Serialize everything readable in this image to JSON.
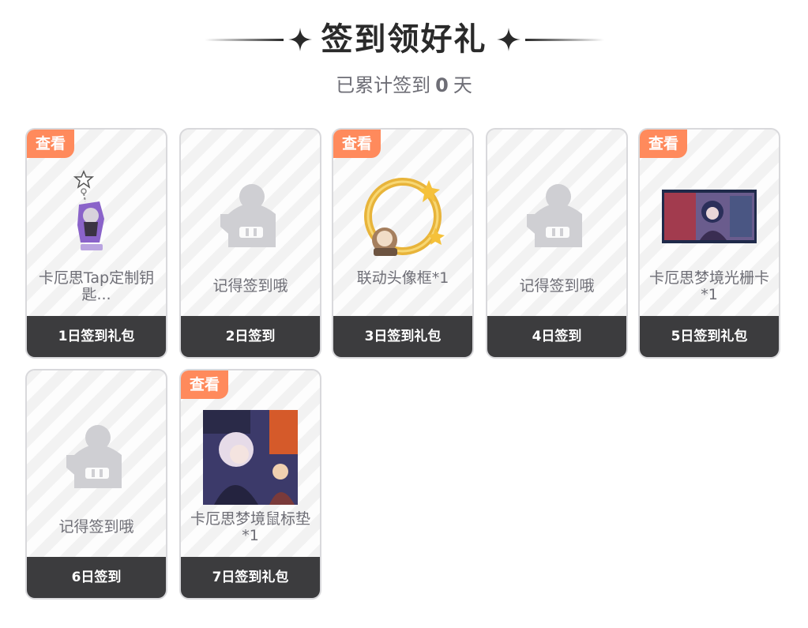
{
  "header": {
    "title": "签到领好礼",
    "subtitle_prefix": "已累计签到",
    "count": "0",
    "subtitle_suffix": "天"
  },
  "rewards": [
    {
      "badge": "查看",
      "name": "卡厄思Tap定制钥匙...",
      "day": "1日签到礼包",
      "icon": "acrylic-keychain-icon"
    },
    {
      "badge": "",
      "name": "记得签到哦",
      "day": "2日签到",
      "icon": "placeholder-mascot-icon"
    },
    {
      "badge": "查看",
      "name": "联动头像框*1",
      "day": "3日签到礼包",
      "icon": "avatar-frame-icon"
    },
    {
      "badge": "",
      "name": "记得签到哦",
      "day": "4日签到",
      "icon": "placeholder-mascot-icon"
    },
    {
      "badge": "查看",
      "name": "卡厄思梦境光栅卡*1",
      "day": "5日签到礼包",
      "icon": "lenticular-card-icon"
    },
    {
      "badge": "",
      "name": "记得签到哦",
      "day": "6日签到",
      "icon": "placeholder-mascot-icon"
    },
    {
      "badge": "查看",
      "name": "卡厄思梦境鼠标垫*1",
      "day": "7日签到礼包",
      "icon": "mousepad-icon"
    }
  ],
  "colors": {
    "badge": "#ff8a5c",
    "day_bar": "#3c3c3e",
    "title": "#2a2a2a",
    "text_muted": "#6e6e76"
  }
}
